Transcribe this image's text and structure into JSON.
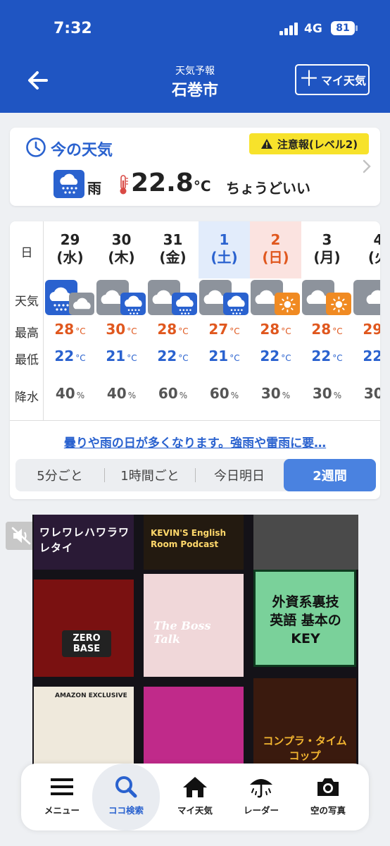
{
  "status_bar": {
    "time": "7:32",
    "network": "4G",
    "battery": "81"
  },
  "header": {
    "subtitle": "天気予報",
    "title": "石巻市",
    "my_weather_button": "マイ天気",
    "accent_color": "#1f55c2"
  },
  "current": {
    "heading": "今の天気",
    "alert": "注意報(レベル2)",
    "condition": "雨",
    "temperature": "22.8",
    "unit": "°C",
    "comment": "ちょうどいい",
    "condition_icon": "rain-icon"
  },
  "forecast": {
    "row_labels": [
      "日",
      "天気",
      "最高",
      "最低",
      "降水"
    ],
    "days": [
      {
        "date": "29",
        "weekday": "(水)",
        "icon": "rain-then-cloud",
        "high": "28",
        "low": "22",
        "precip": "40"
      },
      {
        "date": "30",
        "weekday": "(木)",
        "icon": "cloud-then-rain",
        "high": "30",
        "low": "21",
        "precip": "40"
      },
      {
        "date": "31",
        "weekday": "(金)",
        "icon": "cloud-then-rain",
        "high": "28",
        "low": "22",
        "precip": "60"
      },
      {
        "date": "1",
        "weekday": "(土)",
        "icon": "cloud-then-rain",
        "high": "27",
        "low": "21",
        "precip": "60"
      },
      {
        "date": "2",
        "weekday": "(日)",
        "icon": "cloud-then-sun",
        "high": "28",
        "low": "22",
        "precip": "30"
      },
      {
        "date": "3",
        "weekday": "(月)",
        "icon": "cloud-then-sun",
        "high": "28",
        "low": "22",
        "precip": "30"
      },
      {
        "date": "4",
        "weekday": "(火",
        "icon": "cloud",
        "high": "29",
        "low": "22",
        "precip": "30"
      }
    ],
    "temp_unit": "°C",
    "precip_unit": "%",
    "summary": "曇りや雨の日が多くなります。強雨や雷雨に要…",
    "tabs": [
      "5分ごと",
      "1時間ごと",
      "今日明日",
      "2週間"
    ],
    "selected_tab": "2週間"
  },
  "ad": {
    "tiles": [
      "ワレワレハワラワレタイ",
      "KEVIN'S English Room Podcast",
      "ZERO BASE",
      "The Boss Talk",
      "外資系裏技英語 基本のKEY",
      "AMAZON EXCLUSIVE",
      "コンプラ・タイムコップ"
    ]
  },
  "bottom_nav": [
    {
      "label": "メニュー",
      "icon": "menu-icon"
    },
    {
      "label": "ココ検索",
      "icon": "search-icon"
    },
    {
      "label": "マイ天気",
      "icon": "home-icon"
    },
    {
      "label": "レーダー",
      "icon": "umbrella-icon"
    },
    {
      "label": "空の写真",
      "icon": "camera-icon"
    }
  ]
}
